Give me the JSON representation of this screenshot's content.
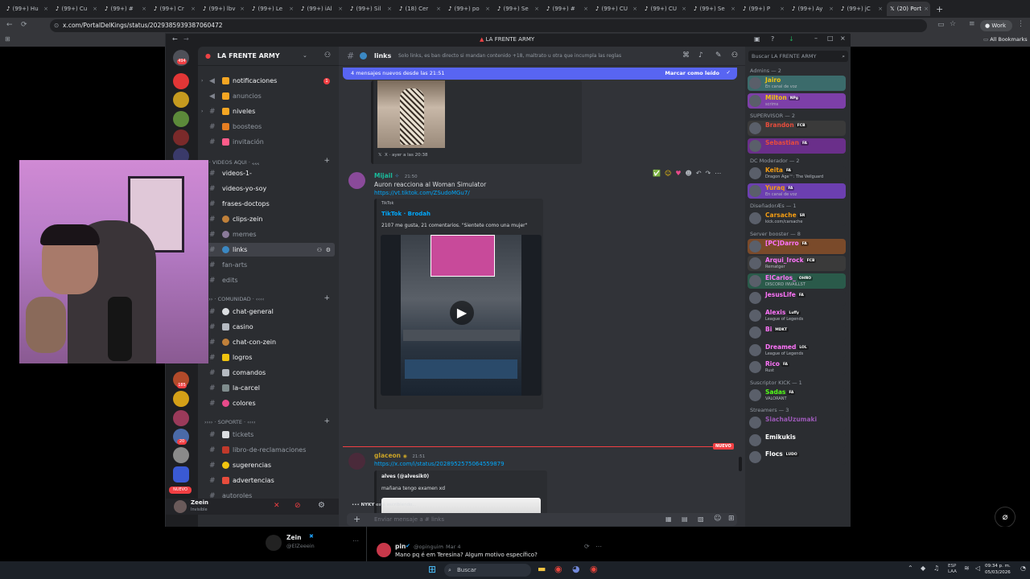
{
  "browser": {
    "tabs": [
      {
        "label": "(99+) Hu"
      },
      {
        "label": "(99+) Cu"
      },
      {
        "label": "(99+) #"
      },
      {
        "label": "(99+) Cr"
      },
      {
        "label": "(99+) lbv"
      },
      {
        "label": "(99+) Le"
      },
      {
        "label": "(99+) iAl"
      },
      {
        "label": "(99+) Sil"
      },
      {
        "label": "(18) Cer"
      },
      {
        "label": "(99+) po"
      },
      {
        "label": "(99+) Se"
      },
      {
        "label": "(99+) #"
      },
      {
        "label": "(99+) CU"
      },
      {
        "label": "(99+) CU"
      },
      {
        "label": "(99+) Se"
      },
      {
        "label": "(99+) P"
      },
      {
        "label": "(99+) Ay"
      },
      {
        "label": "(99+) jC"
      }
    ],
    "active_tab": "(20) Port",
    "url": "x.com/PortalDelKings/status/2029385939387060472",
    "profile": "Work",
    "bookmarks_label": "All Bookmarks"
  },
  "discord": {
    "window_title": "LA FRENTE ARMY",
    "server_name": "LA FRENTE ARMY",
    "channels_top": [
      {
        "label": "notificaciones",
        "bright": true,
        "badge": "1",
        "emoji_color": "#f5a623"
      },
      {
        "label": "anuncios",
        "bright": false,
        "emoji_color": "#f5a623"
      },
      {
        "label": "niveles",
        "bright": true,
        "emoji_color": "#f5a623"
      },
      {
        "label": "boosteos",
        "bright": false,
        "emoji_color": "#e67e22"
      },
      {
        "label": "invitación",
        "bright": false,
        "emoji_color": "#ff5c8a"
      }
    ],
    "category_videos": "៸៸ · VIDEOS AQUI · ៹៹៹",
    "channels_videos": [
      {
        "label": "videos-1-",
        "bright": true
      },
      {
        "label": "videos-yo-soy",
        "bright": true
      },
      {
        "label": "frases-doctops",
        "bright": true
      },
      {
        "label": "clips-zein",
        "bright": true
      },
      {
        "label": "memes",
        "bright": false
      },
      {
        "label": "links",
        "bright": true,
        "selected": true
      },
      {
        "label": "fan-arts",
        "bright": false
      },
      {
        "label": "edits",
        "bright": false
      }
    ],
    "category_comunidad": "›››› · COMUNIDAD · ‹‹‹‹",
    "channels_comunidad": [
      {
        "label": "chat-general",
        "bright": true
      },
      {
        "label": "casino",
        "bright": true
      },
      {
        "label": "chat-con-zein",
        "bright": true
      },
      {
        "label": "logros",
        "bright": true
      },
      {
        "label": "comandos",
        "bright": true
      },
      {
        "label": "la-carcel",
        "bright": true
      },
      {
        "label": "colores",
        "bright": true
      }
    ],
    "category_soporte": "›››› · SOPORTE · ‹‹‹‹",
    "channels_soporte": [
      {
        "label": "tickets",
        "bright": false
      },
      {
        "label": "libro-de-reclamaciones",
        "bright": false
      },
      {
        "label": "sugerencias",
        "bright": true
      },
      {
        "label": "advertencias",
        "bright": true
      },
      {
        "label": "autoroles",
        "bright": false
      }
    ],
    "user": {
      "name": "Zeein",
      "status": "Invisible"
    },
    "guild_badges": [
      "494",
      "185",
      "20",
      "NUEVO"
    ],
    "chat": {
      "channel_name": "links",
      "topic": "Solo links, es ban directo si mandan contenido +18, maltrato u otra que incumpla las reglas",
      "new_messages_bar": "4 mensajes nuevos desde las 21:51",
      "mark_read": "Marcar como leído",
      "embed1_footer": "X · ayer a las 20:38",
      "msg1": {
        "author": "Mijail",
        "time": "21:50",
        "text": "Auron reacciona al Woman Simulator",
        "link": "https://vt.tiktok.com/ZSudoMGu7/",
        "embed_provider": "TikTok",
        "embed_title": "TikTok · Brodah",
        "embed_desc": "2107 me gusta, 21 comentarios. \"Sientete como una mujer\""
      },
      "new_divider": "NUEVO",
      "msg2": {
        "author": "glaceon",
        "time": "21:51",
        "link": "https://x.com/i/status/2028952575064559879",
        "embed_author": "alves (@alvesik0)",
        "embed_text": "mañana tengo examen xd"
      },
      "typing": "NYKY",
      "typing_suffix": "está escribiendo...",
      "composer_placeholder": "Enviar mensaje a #",
      "composer_channel": "links"
    },
    "members": {
      "search_placeholder": "Buscar LA FRENTE ARMY",
      "groups": [
        {
          "title": "Admins — 2",
          "members": [
            {
              "name": "Jairo",
              "sub": "En canal de voz",
              "color": "#f1c40f",
              "bg": "#3b6b6b",
              "tag": ""
            },
            {
              "name": "Milton",
              "sub": "scrims",
              "color": "#f1c40f",
              "bg": "#7d3fa8",
              "tag": "NPg"
            }
          ]
        },
        {
          "title": "SUPERVISOR — 2",
          "members": [
            {
              "name": "Brandon",
              "sub": "",
              "color": "#e74c3c",
              "bg": "#3a3a3a",
              "tag": "FCB"
            },
            {
              "name": "Sebastian",
              "sub": "",
              "color": "#e74c3c",
              "bg": "#6a2f8a",
              "tag": "FA"
            }
          ]
        },
        {
          "title": "DC Moderador — 2",
          "members": [
            {
              "name": "Keita",
              "sub": "Dragon Age™: The Veilguard",
              "color": "#f39c12",
              "bg": "#2b2d31",
              "tag": "FA"
            },
            {
              "name": "Yuraq",
              "sub": "En canal de voz",
              "color": "#f39c12",
              "bg": "#6c3fb0",
              "tag": "FA"
            }
          ]
        },
        {
          "title": "DiseñadorÆs — 1",
          "members": [
            {
              "name": "Carsache",
              "sub": "kick.com/carsache",
              "color": "#f39c12",
              "bg": "#2b2d31",
              "tag": "SR"
            }
          ]
        },
        {
          "title": "Server booster — 8",
          "members": [
            {
              "name": "[PC]Darro",
              "sub": "",
              "color": "#ff73fa",
              "bg": "#7a4a2a",
              "tag": "FA"
            },
            {
              "name": "Arqui_Irock",
              "sub": "Rematger",
              "color": "#ff73fa",
              "bg": "#3a3a3a",
              "tag": "FCB"
            },
            {
              "name": "ElCarlos_",
              "sub": "DISCORD INVAILLST",
              "color": "#ff73fa",
              "bg": "#2a5a4a",
              "tag": "OHÑO"
            },
            {
              "name": "JesusLife",
              "sub": "",
              "color": "#ff73fa",
              "bg": "#2b2d31",
              "tag": "FA"
            },
            {
              "name": "Alexis",
              "sub": "League of Legends",
              "color": "#ff73fa",
              "bg": "#2b2d31",
              "tag": "Luffy"
            },
            {
              "name": "Bi",
              "sub": "",
              "color": "#ff73fa",
              "bg": "#2b2d31",
              "tag": "MDKT"
            },
            {
              "name": "Dreamed",
              "sub": "League of Legends",
              "color": "#ff73fa",
              "bg": "#2b2d31",
              "tag": "LOL"
            },
            {
              "name": "Rico",
              "sub": "Rust",
              "color": "#ff73fa",
              "bg": "#2b2d31",
              "tag": "FA"
            }
          ]
        },
        {
          "title": "Suscriptor KICK — 1",
          "members": [
            {
              "name": "Sadas",
              "sub": "VALORANT",
              "color": "#53fc18",
              "bg": "#2b2d31",
              "tag": "FA"
            }
          ]
        },
        {
          "title": "Streamers — 3",
          "members": [
            {
              "name": "SiachaUzumaki",
              "sub": "",
              "color": "#9b59b6",
              "bg": "#2b2d31",
              "tag": ""
            },
            {
              "name": "Emikukis",
              "sub": "",
              "color": "#ffffff",
              "bg": "#2b2d31",
              "tag": ""
            },
            {
              "name": "Flocs",
              "sub": "",
              "color": "#ffffff",
              "bg": "#2b2d31",
              "tag": "LUDO"
            }
          ]
        }
      ]
    }
  },
  "xpage": {
    "author_name": "Zein",
    "author_handle": "@ElZeeein",
    "reply_author": "pin",
    "reply_handle": "@opinguim",
    "reply_date": "Mar 4",
    "reply_text": "Mano pq é em Teresina? Algum motivo específico?"
  },
  "taskbar": {
    "search": "Buscar",
    "lang1": "ESP",
    "lang2": "LAA",
    "time": "09:34 p. m.",
    "date": "05/03/2026"
  }
}
